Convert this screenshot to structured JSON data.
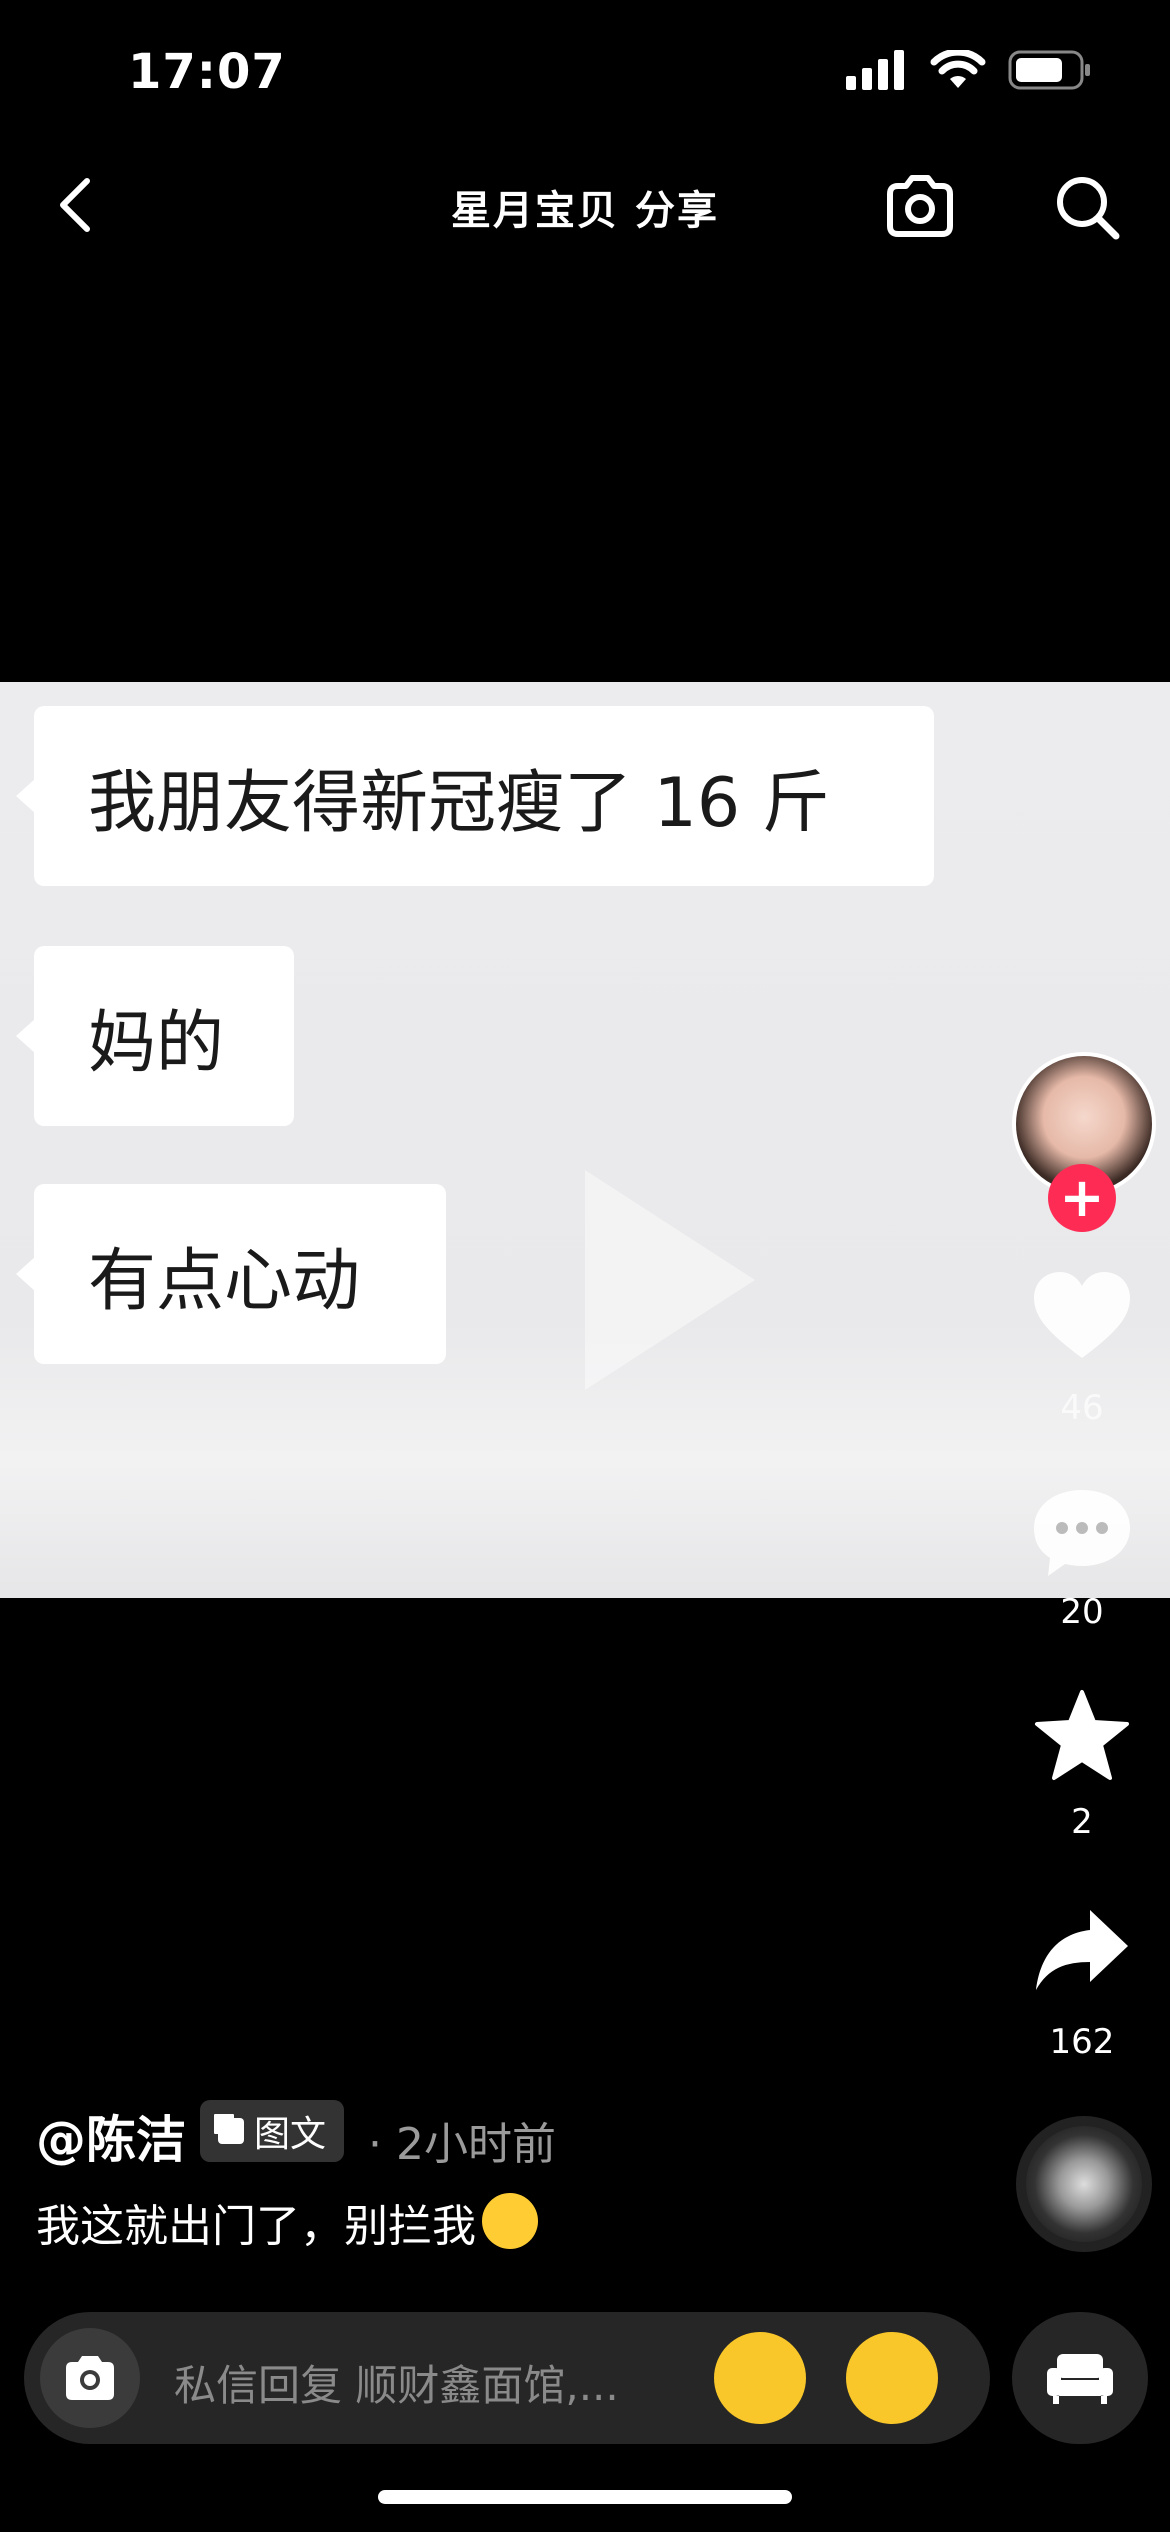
{
  "status_bar": {
    "time": "17:07"
  },
  "header": {
    "title": "星月宝贝 分享"
  },
  "content": {
    "messages": [
      "我朋友得新冠瘦了 16 斤",
      "妈的",
      "有点心动"
    ]
  },
  "actions": {
    "likes": "46",
    "comments": "20",
    "favorites": "2",
    "shares": "162"
  },
  "post": {
    "author": "@陈洁",
    "type_tag": "图文",
    "time_ago": "· 2小时前",
    "caption": "我这就出门了，别拦我"
  },
  "input": {
    "placeholder": "私信回复 顺财鑫面馆,..."
  },
  "colors": {
    "accent": "#fe2c55",
    "background": "#000000"
  },
  "icons": [
    "back-icon",
    "camera-icon",
    "search-icon",
    "heart-icon",
    "comment-icon",
    "star-icon",
    "share-icon",
    "sofa-icon"
  ]
}
